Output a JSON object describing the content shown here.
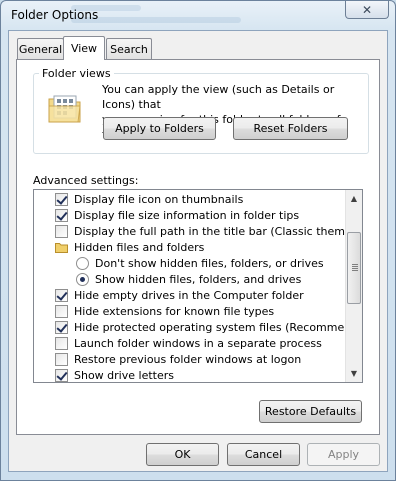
{
  "window": {
    "title": "Folder Options",
    "close_glyph": "✕"
  },
  "tabs": [
    {
      "label": "General",
      "active": false
    },
    {
      "label": "View",
      "active": true
    },
    {
      "label": "Search",
      "active": false
    }
  ],
  "folder_views": {
    "caption": "Folder views",
    "description_line1": "You can apply the view (such as Details or Icons) that",
    "description_line2": "you are using for this folder to all folders of this type.",
    "apply_button": "Apply to Folders",
    "reset_button": "Reset Folders",
    "icon": "folder-options-icon"
  },
  "advanced": {
    "label": "Advanced settings:",
    "items": [
      {
        "type": "checkbox",
        "checked": true,
        "label": "Display file icon on thumbnails"
      },
      {
        "type": "checkbox",
        "checked": true,
        "label": "Display file size information in folder tips"
      },
      {
        "type": "checkbox",
        "checked": false,
        "label": "Display the full path in the title bar (Classic theme only)"
      },
      {
        "type": "folder",
        "label": "Hidden files and folders"
      },
      {
        "type": "radio",
        "checked": false,
        "label": "Don't show hidden files, folders, or drives"
      },
      {
        "type": "radio",
        "checked": true,
        "label": "Show hidden files, folders, and drives"
      },
      {
        "type": "checkbox",
        "checked": true,
        "label": "Hide empty drives in the Computer folder"
      },
      {
        "type": "checkbox",
        "checked": false,
        "label": "Hide extensions for known file types"
      },
      {
        "type": "checkbox",
        "checked": true,
        "label": "Hide protected operating system files (Recommended)"
      },
      {
        "type": "checkbox",
        "checked": false,
        "label": "Launch folder windows in a separate process"
      },
      {
        "type": "checkbox",
        "checked": false,
        "label": "Restore previous folder windows at logon"
      },
      {
        "type": "checkbox",
        "checked": true,
        "label": "Show drive letters"
      }
    ],
    "restore_defaults": "Restore Defaults"
  },
  "footer": {
    "ok": "OK",
    "cancel": "Cancel",
    "apply": "Apply"
  }
}
